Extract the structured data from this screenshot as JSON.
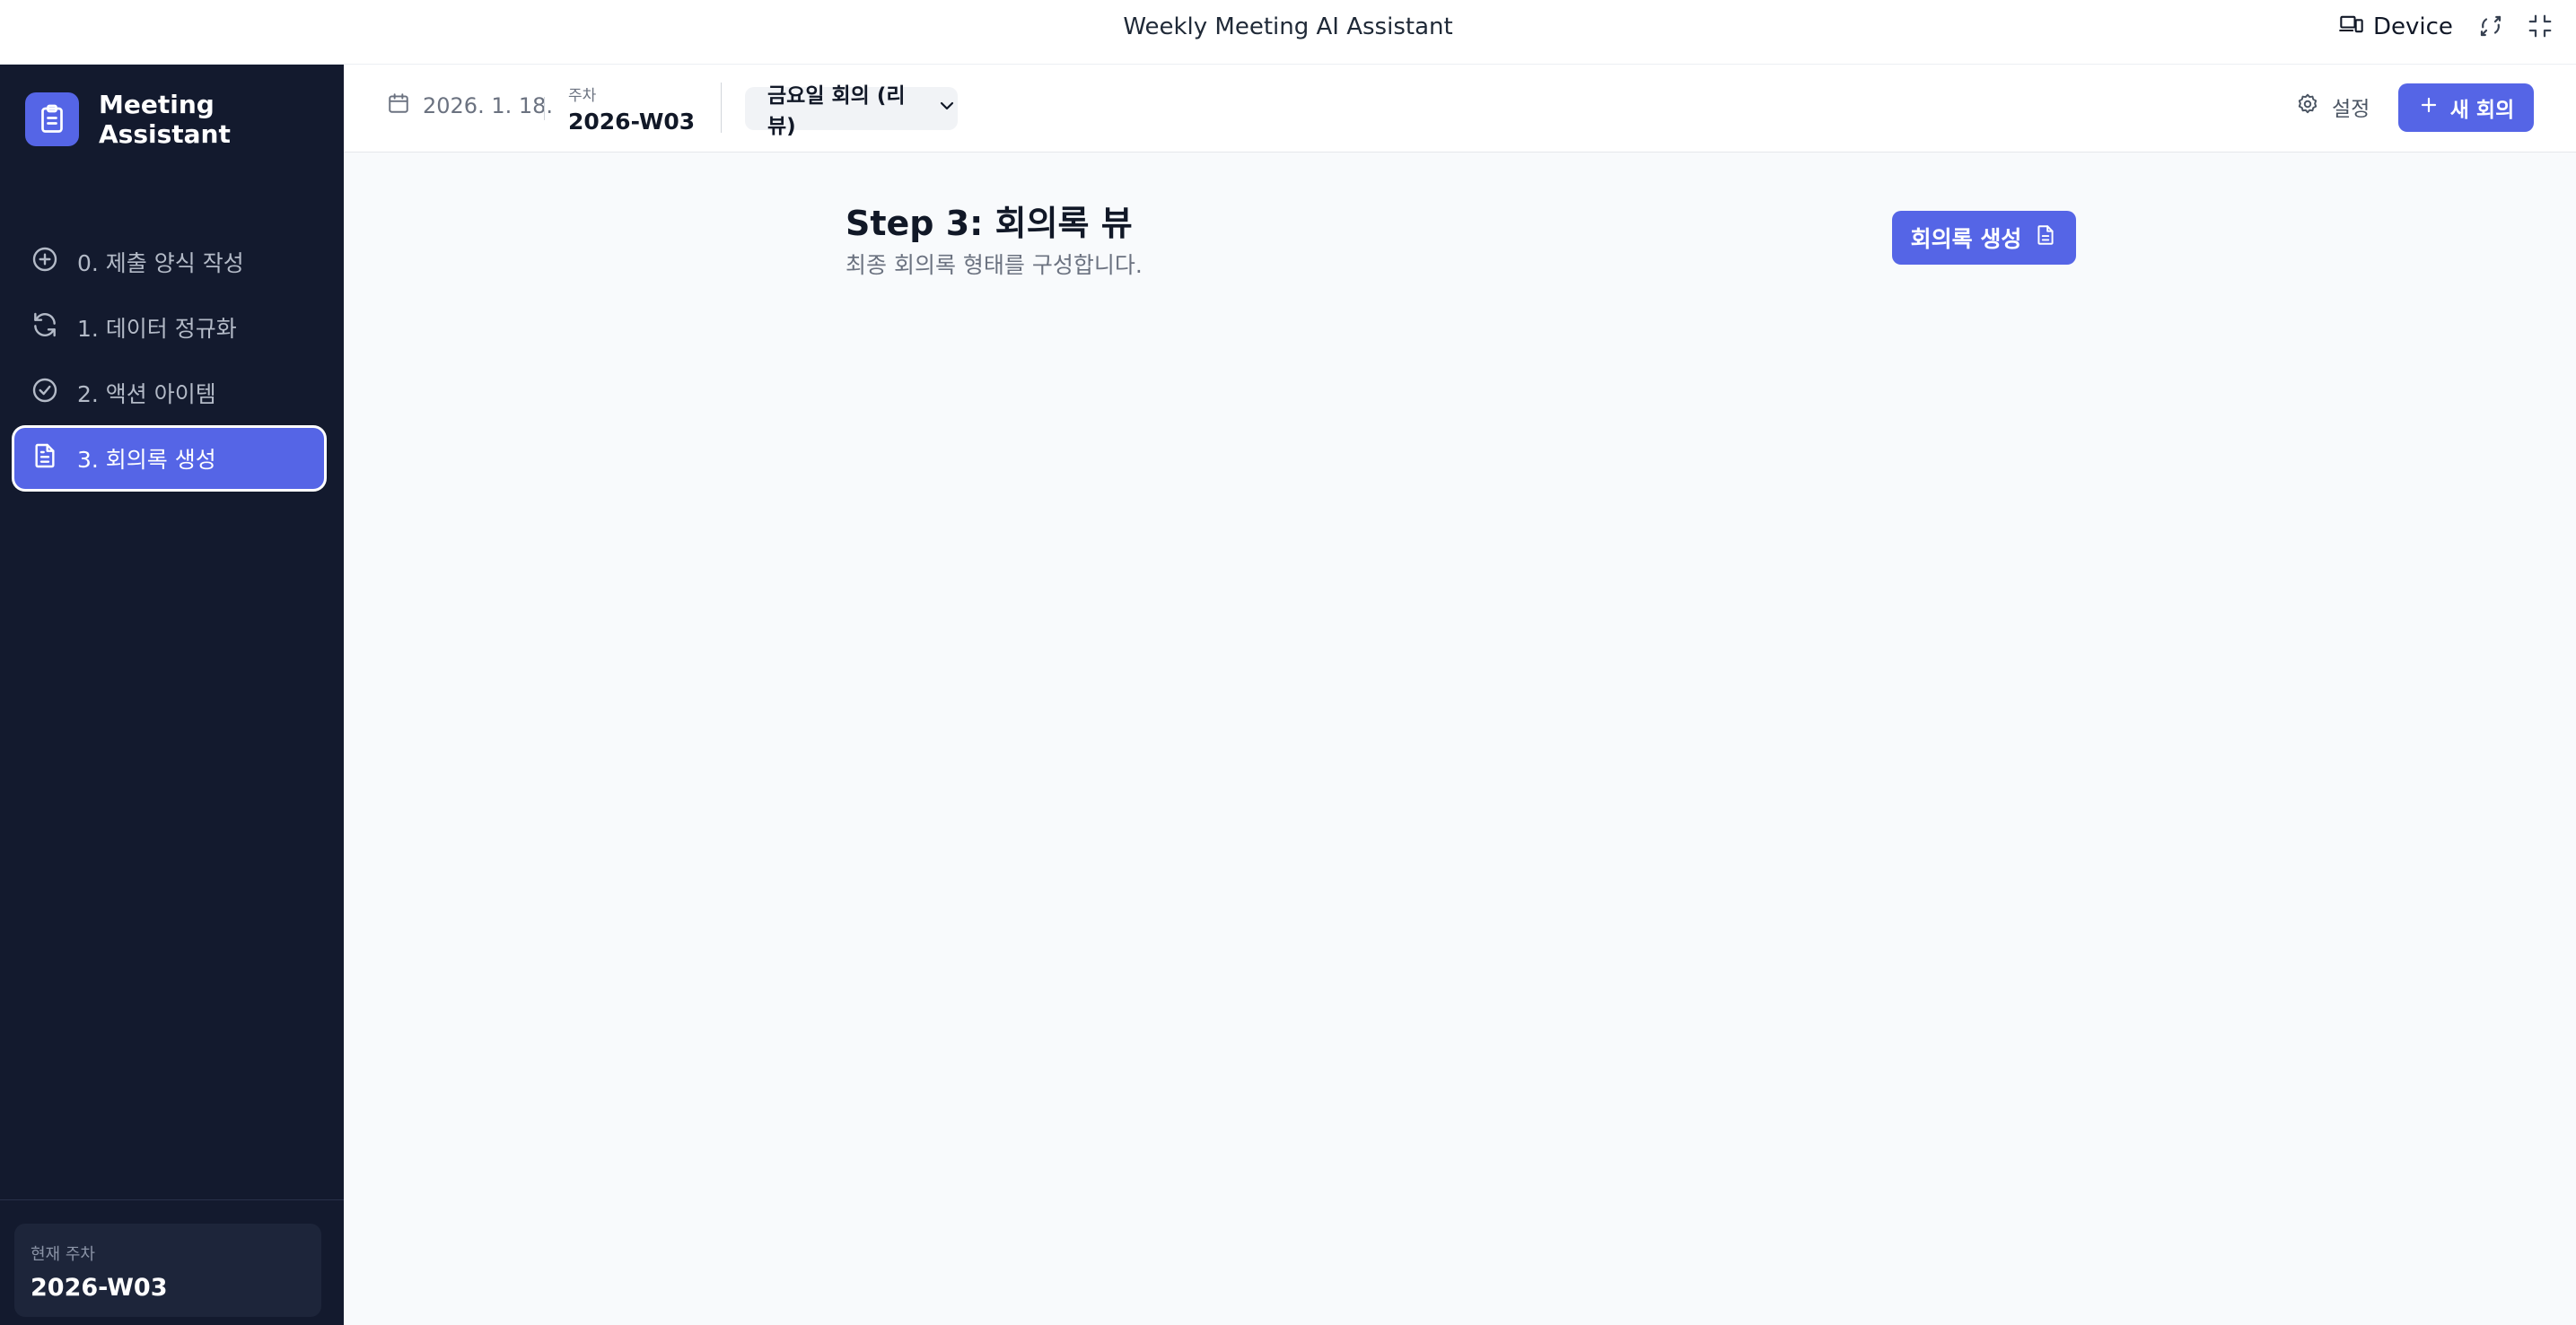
{
  "window": {
    "title": "Weekly Meeting AI Assistant",
    "device_label": "Device"
  },
  "sidebar": {
    "brand": "Meeting Assistant",
    "items": [
      {
        "label": "0. 제출 양식 작성",
        "icon": "plus-circle-icon"
      },
      {
        "label": "1. 데이터 정규화",
        "icon": "refresh-icon"
      },
      {
        "label": "2. 액션 아이템",
        "icon": "check-circle-icon"
      },
      {
        "label": "3. 회의록 생성",
        "icon": "document-icon",
        "active": true
      }
    ],
    "current_week_label": "현재 주차",
    "current_week_value": "2026-W03"
  },
  "header": {
    "date": "2026. 1. 18.",
    "week_label": "주차",
    "week_value": "2026-W03",
    "meeting_select": "금요일 회의 (리뷰)",
    "settings_label": "설정",
    "new_meeting_label": "새 회의"
  },
  "main": {
    "step_title": "Step 3: 회의록 뷰",
    "step_subtitle": "최종 회의록 형태를 구성합니다.",
    "generate_label": "회의록 생성"
  },
  "colors": {
    "accent": "#5565e6",
    "sidebar_bg": "#131a2e",
    "main_bg": "#f8fafc"
  }
}
